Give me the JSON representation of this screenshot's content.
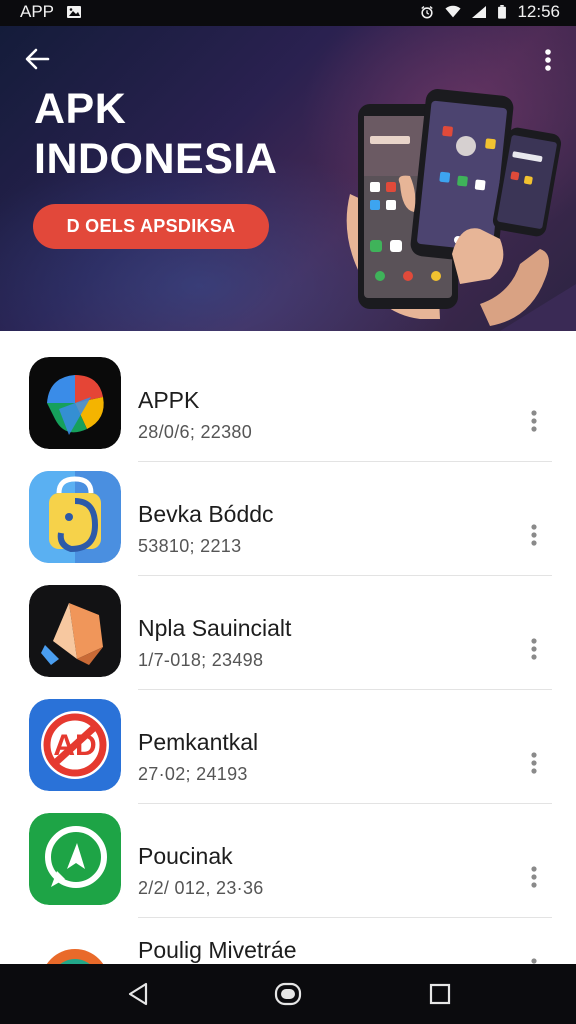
{
  "status_bar": {
    "app_label": "APP",
    "time": "12:56",
    "icons": [
      "image-icon",
      "alarm-icon",
      "wifi-icon",
      "signal-icon",
      "battery-icon"
    ]
  },
  "header": {
    "back_icon": "back-arrow-icon",
    "more_icon": "more-vertical-icon",
    "title_line1": "APK",
    "title_line2": "INDONESIA",
    "promo_button": "D OELS APSDIKSA",
    "accent_color": "#e2483a"
  },
  "apps": [
    {
      "name": "APPK",
      "meta": "28/0/6; 22380",
      "icon": "colorful-play-arrow-icon"
    },
    {
      "name": "Bevka Bóddc",
      "meta": "53810; 2213",
      "icon": "blue-yellow-bag-icon"
    },
    {
      "name": "Npla Sauincialt",
      "meta": "1/7-018; 23498",
      "icon": "orange-geometric-shape-icon"
    },
    {
      "name": "Pemkantkal",
      "meta": "27·02; 24193",
      "icon": "ad-block-icon"
    },
    {
      "name": "Poucinak",
      "meta": "2/2/ 012, 23·36",
      "icon": "green-chat-bubble-icon"
    },
    {
      "name": "Poulig Mivetráe",
      "meta": "",
      "icon": "orange-circle-icon"
    }
  ],
  "nav_bar": {
    "icons": [
      "nav-back-icon",
      "nav-home-icon",
      "nav-recents-icon"
    ]
  }
}
